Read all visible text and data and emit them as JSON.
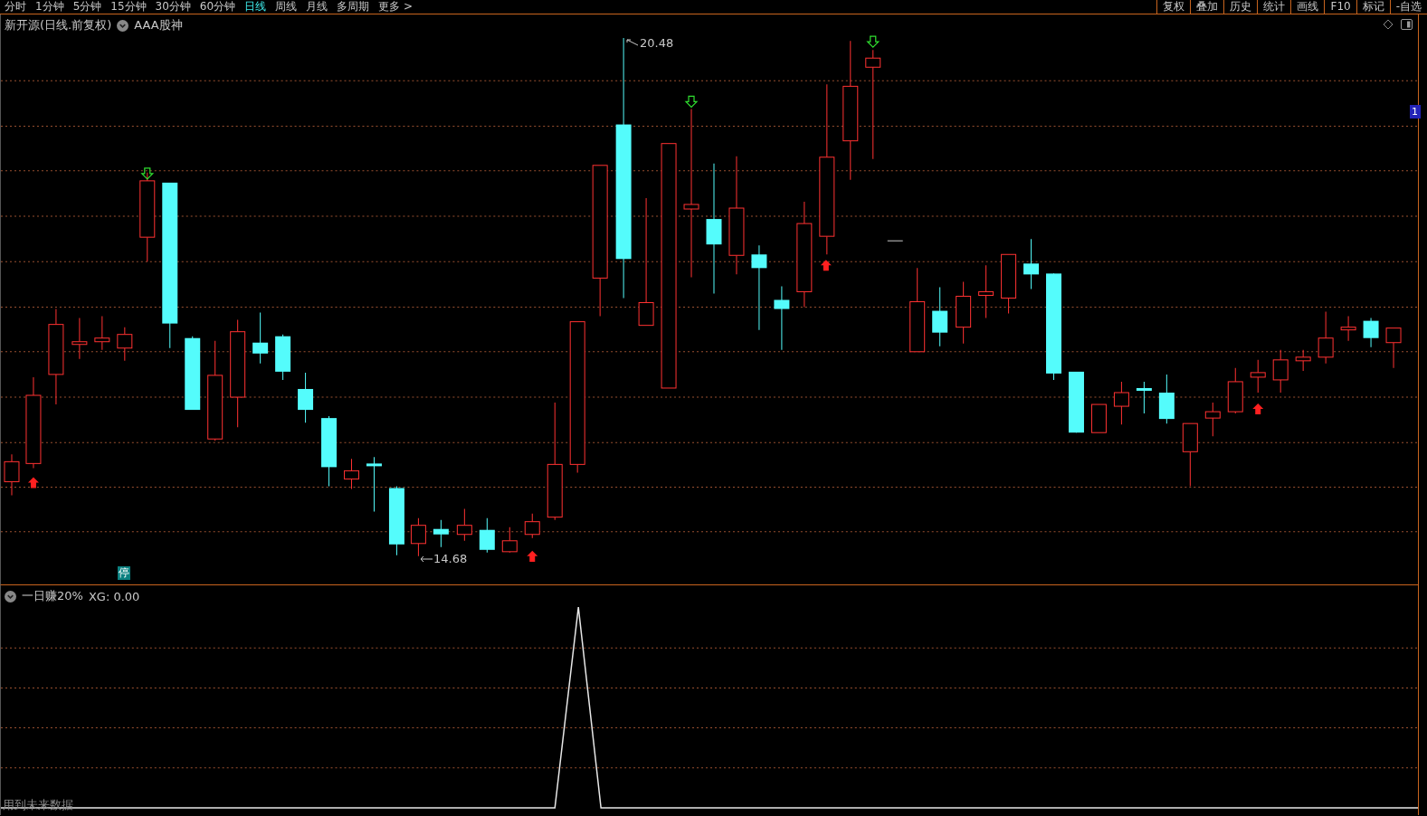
{
  "menu": {
    "periods": [
      {
        "label": "分时",
        "selected": false
      },
      {
        "label": "1分钟",
        "selected": false
      },
      {
        "label": "5分钟",
        "selected": false
      },
      {
        "label": "15分钟",
        "selected": false
      },
      {
        "label": "30分钟",
        "selected": false
      },
      {
        "label": "60分钟",
        "selected": false
      },
      {
        "label": "日线",
        "selected": true
      },
      {
        "label": "周线",
        "selected": false
      },
      {
        "label": "月线",
        "selected": false
      },
      {
        "label": "多周期",
        "selected": false
      },
      {
        "label": "更多 >",
        "selected": false
      }
    ],
    "tools": [
      "复权",
      "叠加",
      "历史",
      "统计",
      "画线",
      "F10",
      "标记",
      "-自选"
    ]
  },
  "price_pane": {
    "title": "新开源(日线.前复权)",
    "indicator": "AAA股神",
    "high_label": "20.48",
    "low_label": "14.68",
    "badge": "停",
    "price_tag": "1"
  },
  "indicator_pane": {
    "title": "一日赚20%",
    "reading": "XG: 0.00",
    "note": "用到未来数据"
  }
}
